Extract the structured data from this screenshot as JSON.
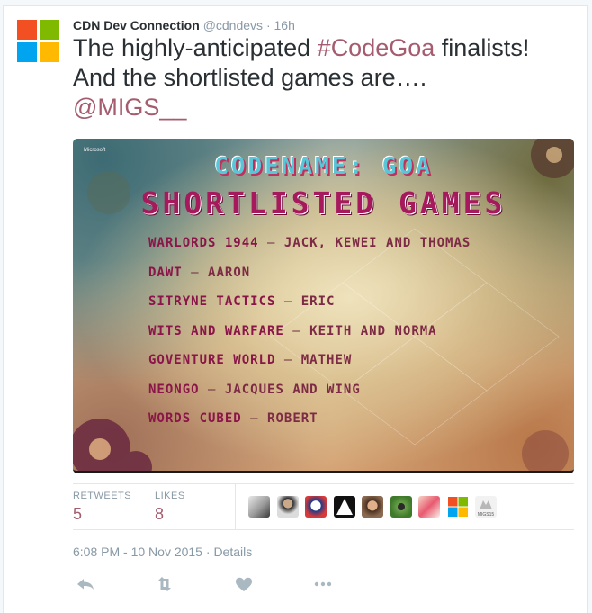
{
  "tweet": {
    "author_name": "CDN Dev Connection",
    "author_handle": "@cdndevs",
    "separator": "·",
    "relative_time": "16h",
    "text_part1": "The highly-anticipated ",
    "hashtag": "#CodeGoa",
    "text_part2": " finalists!",
    "text_line2": "And the shortlisted games are….",
    "mention": "@MIGS__",
    "colors": {
      "link": "#a55c6f",
      "muted": "#8899a6",
      "text": "#292f33"
    }
  },
  "media": {
    "corner_text": "Microsoft",
    "title_line1": "CODENAME: GOA",
    "title_line2": "SHORTLISTED GAMES",
    "games": [
      {
        "name": "WARLORDS 1944",
        "authors": "JACK, KEWEI AND THOMAS"
      },
      {
        "name": "DAWT",
        "authors": "AARON"
      },
      {
        "name": "SITRYNE TACTICS",
        "authors": "ERIC"
      },
      {
        "name": "WITS AND WARFARE",
        "authors": "KEITH AND NORMA"
      },
      {
        "name": "GOVENTURE WORLD",
        "authors": "MATHEW"
      },
      {
        "name": "NEONGO",
        "authors": "JACQUES AND WING"
      },
      {
        "name": "WORDS CUBED",
        "authors": "ROBERT"
      }
    ],
    "dash": "–"
  },
  "stats": {
    "retweets_label": "RETWEETS",
    "retweets_count": "5",
    "likes_label": "LIKES",
    "likes_count": "8",
    "faces": [
      "user-avatar-1",
      "user-avatar-2",
      "user-avatar-3",
      "user-avatar-4",
      "user-avatar-5",
      "user-avatar-6",
      "user-avatar-7",
      "microsoft-avatar",
      "migs-avatar"
    ],
    "migs_label": "MIGS15"
  },
  "meta": {
    "timestamp": "6:08 PM - 10 Nov 2015",
    "separator": "·",
    "details": "Details"
  },
  "actions": [
    "reply-icon",
    "retweet-icon",
    "like-icon",
    "more-icon"
  ]
}
